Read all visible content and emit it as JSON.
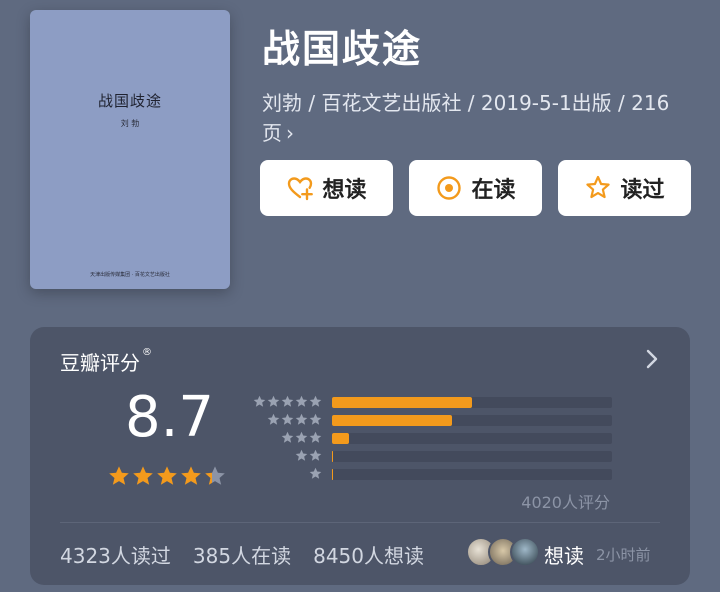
{
  "book": {
    "title": "战国歧途",
    "meta": "刘勃 / 百花文艺出版社 / 2019-5-1出版 / 216页",
    "cover": {
      "title": "战国歧途",
      "author": "刘 勃",
      "publisher": "天津出版传媒集团 · 百花文艺出版社"
    }
  },
  "actions": [
    {
      "label": "想读",
      "icon": "heart-plus-icon"
    },
    {
      "label": "在读",
      "icon": "circle-dot-icon"
    },
    {
      "label": "读过",
      "icon": "star-outline-icon"
    }
  ],
  "rating": {
    "title": "豆瓣评分",
    "mark": "®",
    "score": "8.7",
    "stars": 4.35,
    "distribution": [
      {
        "stars": 5,
        "percent": 50
      },
      {
        "stars": 4,
        "percent": 43
      },
      {
        "stars": 3,
        "percent": 6
      },
      {
        "stars": 2,
        "percent": 0.5
      },
      {
        "stars": 1,
        "percent": 0.3
      }
    ],
    "count_label": "4020人评分"
  },
  "stats": {
    "read": "4323人读过",
    "reading": "385人在读",
    "want": "8450人想读"
  },
  "activity": {
    "label": "想读",
    "time": "2小时前"
  },
  "colors": {
    "background": "#5f6a80",
    "card": "#4d5568",
    "accent": "#f39a1c",
    "cover": "#8d9dc4"
  }
}
